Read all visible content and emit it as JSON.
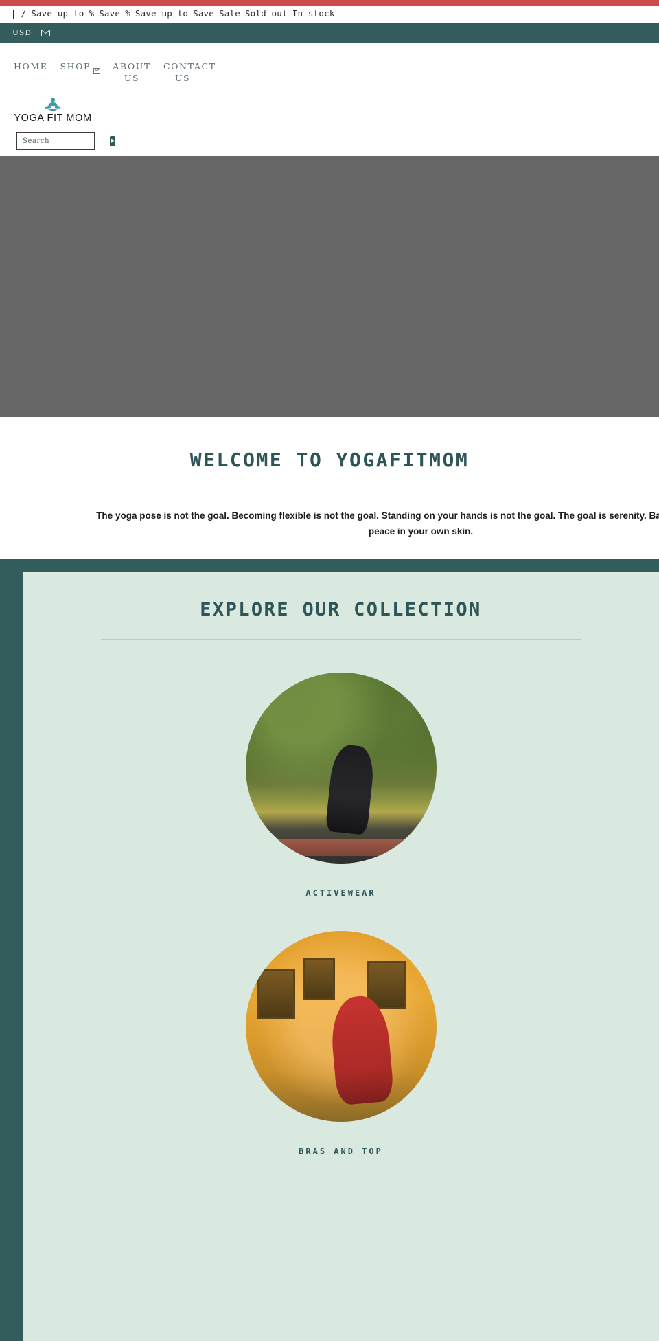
{
  "colors": {
    "accent_red": "#cf4b4b",
    "teal_dark": "#335c5c",
    "teal_text": "#2e5558",
    "mint_panel": "#d9e9df",
    "hero_gray": "#676767",
    "nav_text": "#5d6b72"
  },
  "announcement": {
    "items": [
      "-",
      "|",
      "/",
      "Save up to",
      "%",
      "Save",
      "%",
      "Save up to",
      "Save",
      "Sale",
      "Sold out",
      "In stock"
    ]
  },
  "utility_bar": {
    "currency": "USD",
    "mail_icon": "mail-icon"
  },
  "nav": {
    "items": [
      {
        "label": "HOME",
        "has_dropdown": false,
        "second_line": ""
      },
      {
        "label": "SHOP",
        "has_dropdown": true,
        "second_line": ""
      },
      {
        "label": "ABOUT",
        "has_dropdown": false,
        "second_line": "US"
      },
      {
        "label": "CONTACT",
        "has_dropdown": false,
        "second_line": "US"
      }
    ]
  },
  "brand": {
    "name": "YOGA FIT MOM",
    "figure_icon": "meditating-person-icon"
  },
  "search": {
    "placeholder": "Search",
    "value": "",
    "submit_icon": "play-arrow-icon"
  },
  "hero": {
    "alt": "hero-banner"
  },
  "welcome": {
    "title": "WELCOME TO YOGAFITMOM",
    "body": "The yoga pose is not the goal. Becoming flexible is not the goal. Standing on your hands is not the goal. The goal is serenity. Balance. Truly finding peace in your own skin."
  },
  "collection": {
    "title": "EXPLORE OUR COLLECTION",
    "categories": [
      {
        "label": "ACTIVEWEAR",
        "image": "activewear-photo"
      },
      {
        "label": "BRAS AND TOP",
        "image": "bras-and-top-photo"
      }
    ]
  }
}
